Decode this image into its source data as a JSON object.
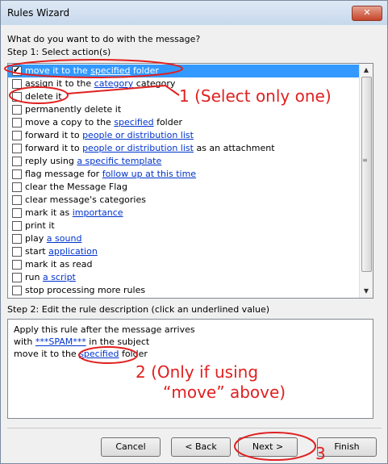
{
  "window": {
    "title": "Rules Wizard",
    "close_label": "✕"
  },
  "prompt": "What do you want to do with the message?",
  "step1": {
    "label": "Step 1: Select action(s)",
    "actions": [
      {
        "checked": true,
        "selected": true,
        "parts": [
          "move it to the ",
          "specified",
          " folder"
        ]
      },
      {
        "checked": false,
        "parts": [
          "assign it to the ",
          "category",
          " category"
        ]
      },
      {
        "checked": false,
        "parts": [
          "delete it"
        ]
      },
      {
        "checked": false,
        "parts": [
          "permanently delete it"
        ]
      },
      {
        "checked": false,
        "parts": [
          "move a copy to the ",
          "specified",
          " folder"
        ]
      },
      {
        "checked": false,
        "parts": [
          "forward it to ",
          "people or distribution list"
        ]
      },
      {
        "checked": false,
        "parts": [
          "forward it to ",
          "people or distribution list",
          " as an attachment"
        ]
      },
      {
        "checked": false,
        "parts": [
          "reply using ",
          "a specific template"
        ]
      },
      {
        "checked": false,
        "parts": [
          "flag message for ",
          "follow up at this time"
        ]
      },
      {
        "checked": false,
        "parts": [
          "clear the Message Flag"
        ]
      },
      {
        "checked": false,
        "parts": [
          "clear message's categories"
        ]
      },
      {
        "checked": false,
        "parts": [
          "mark it as ",
          "importance"
        ]
      },
      {
        "checked": false,
        "parts": [
          "print it"
        ]
      },
      {
        "checked": false,
        "parts": [
          "play ",
          "a sound"
        ]
      },
      {
        "checked": false,
        "parts": [
          "start ",
          "application"
        ]
      },
      {
        "checked": false,
        "parts": [
          "mark it as read"
        ]
      },
      {
        "checked": false,
        "parts": [
          "run ",
          "a script"
        ]
      },
      {
        "checked": false,
        "parts": [
          "stop processing more rules"
        ]
      }
    ]
  },
  "step2": {
    "label": "Step 2: Edit the rule description (click an underlined value)",
    "lines": [
      {
        "parts": [
          "Apply this rule after the message arrives"
        ]
      },
      {
        "parts": [
          "with ",
          "***SPAM***",
          " in the subject"
        ]
      },
      {
        "parts": [
          "move it to the ",
          "specified",
          " folder"
        ]
      }
    ]
  },
  "buttons": {
    "cancel": "Cancel",
    "back": "< Back",
    "next": "Next >",
    "finish": "Finish"
  },
  "annotations": {
    "note1": "1 (Select only one)",
    "note2_line1": "2 (Only if using",
    "note2_line2": "“move” above)",
    "note3": "3"
  }
}
